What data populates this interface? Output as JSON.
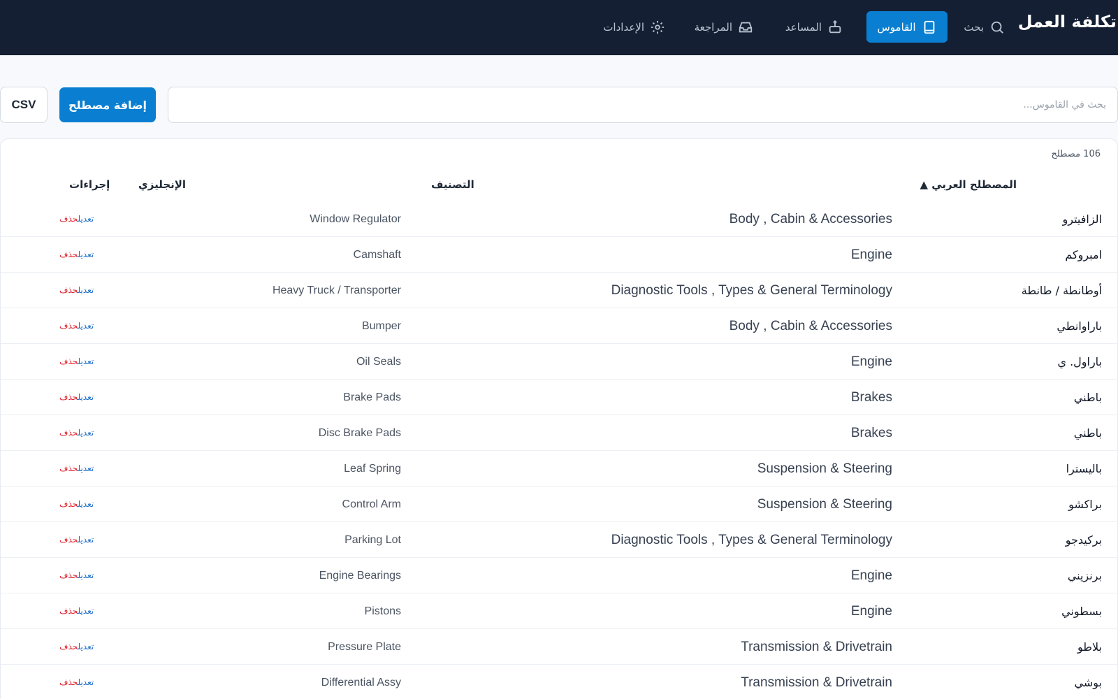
{
  "app": {
    "title": "تكلفة العمل"
  },
  "nav": {
    "search": "بحث",
    "dictionary": "القاموس",
    "assistant": "المساعد",
    "review": "المراجعة",
    "settings": "الإعدادات"
  },
  "toolbar": {
    "search_placeholder": "بحث في القاموس...",
    "add_label": "إضافة مصطلح",
    "csv_label": "CSV"
  },
  "table": {
    "count": "106 مصطلح",
    "headers": {
      "arabic": "المصطلح العربي ▲",
      "category": "التصنيف",
      "english": "الإنجليزي",
      "actions": "إجراءات"
    },
    "action_labels": {
      "edit": "تعديل",
      "delete": "حذف"
    },
    "rows": [
      {
        "arabic": "الزافيترو",
        "category": "Body , Cabin & Accessories",
        "english": "Window Regulator"
      },
      {
        "arabic": "امبروكم",
        "category": "Engine",
        "english": "Camshaft"
      },
      {
        "arabic": "أوطانطة / طانطة",
        "category": "Diagnostic Tools , Types & General Terminology",
        "english": "Heavy Truck / Transporter"
      },
      {
        "arabic": "باراوانطي",
        "category": "Body , Cabin & Accessories",
        "english": "Bumper"
      },
      {
        "arabic": "باراول. ي",
        "category": "Engine",
        "english": "Oil Seals"
      },
      {
        "arabic": "باطني",
        "category": "Brakes",
        "english": "Brake Pads"
      },
      {
        "arabic": "باطني",
        "category": "Brakes",
        "english": "Disc Brake Pads"
      },
      {
        "arabic": "باليسترا",
        "category": "Suspension & Steering",
        "english": "Leaf Spring"
      },
      {
        "arabic": "براكشو",
        "category": "Suspension & Steering",
        "english": "Control Arm"
      },
      {
        "arabic": "بركيدجو",
        "category": "Diagnostic Tools , Types & General Terminology",
        "english": "Parking Lot"
      },
      {
        "arabic": "برنزيني",
        "category": "Engine",
        "english": "Engine Bearings"
      },
      {
        "arabic": "بسطوني",
        "category": "Engine",
        "english": "Pistons"
      },
      {
        "arabic": "بلاطو",
        "category": "Transmission & Drivetrain",
        "english": "Pressure Plate"
      },
      {
        "arabic": "بوشي",
        "category": "Transmission & Drivetrain",
        "english": "Differential Assy"
      }
    ]
  }
}
